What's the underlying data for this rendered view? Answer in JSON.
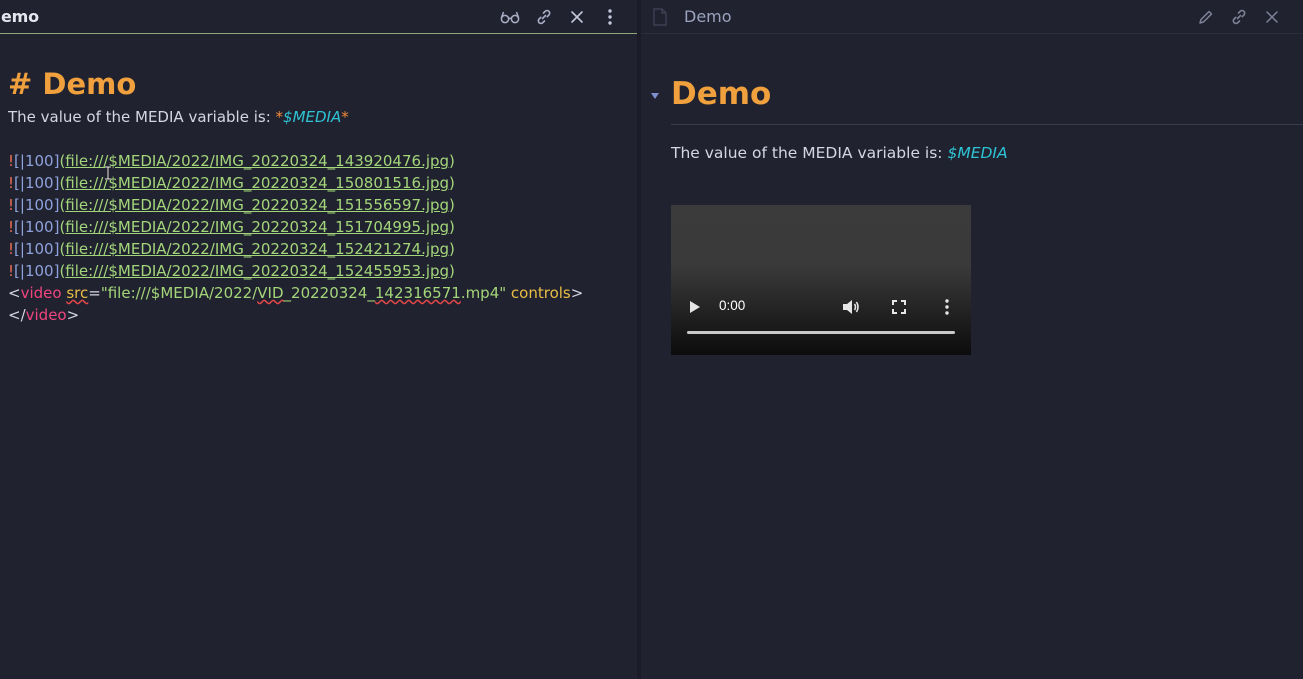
{
  "left_pane": {
    "title": "emo",
    "icons": [
      "reading-glasses-icon",
      "link-icon",
      "close-icon",
      "more-vertical-icon"
    ]
  },
  "right_pane": {
    "title": "Demo",
    "icons": [
      "file-icon",
      "pencil-icon",
      "link-icon",
      "close-icon"
    ]
  },
  "editor": {
    "heading": "# Demo",
    "para_text": "The value of the MEDIA variable is: ",
    "star": "*",
    "para_var": "$MEDIA",
    "images": [
      {
        "bang": "!",
        "alias_open": "[",
        "alias_sep": "|",
        "alias_size": "100",
        "alias_close": "]",
        "open": "(",
        "url": "file:///$MEDIA/2022/IMG_20220324_143920476.jpg",
        "close": ")"
      },
      {
        "bang": "!",
        "alias_open": "[",
        "alias_sep": "|",
        "alias_size": "100",
        "alias_close": "]",
        "open": "(",
        "url": "file:///$MEDIA/2022/IMG_20220324_150801516.jpg",
        "close": ")"
      },
      {
        "bang": "!",
        "alias_open": "[",
        "alias_sep": "|",
        "alias_size": "100",
        "alias_close": "]",
        "open": "(",
        "url": "file:///$MEDIA/2022/IMG_20220324_151556597.jpg",
        "close": ")"
      },
      {
        "bang": "!",
        "alias_open": "[",
        "alias_sep": "|",
        "alias_size": "100",
        "alias_close": "]",
        "open": "(",
        "url": "file:///$MEDIA/2022/IMG_20220324_151704995.jpg",
        "close": ")"
      },
      {
        "bang": "!",
        "alias_open": "[",
        "alias_sep": "|",
        "alias_size": "100",
        "alias_close": "]",
        "open": "(",
        "url": "file:///$MEDIA/2022/IMG_20220324_152421274.jpg",
        "close": ")"
      },
      {
        "bang": "!",
        "alias_open": "[",
        "alias_sep": "|",
        "alias_size": "100",
        "alias_close": "]",
        "open": "(",
        "url": "file:///$MEDIA/2022/IMG_20220324_152455953.jpg",
        "close": ")"
      }
    ],
    "video_line": {
      "lt": "<",
      "tag": "video",
      "sp": " ",
      "attr": "src",
      "eq": "=",
      "q1": "\"",
      "val_a": "file:///$MEDIA/2022/",
      "val_sq1": "VID",
      "val_mid": "_20220324_",
      "val_sq2": "142316571",
      "val_end": ".mp4",
      "q2": "\"",
      "ctrl": " controls",
      "gt": ">"
    },
    "close_line": {
      "lt": "</",
      "tag": "video",
      "gt": ">"
    }
  },
  "preview": {
    "heading": "Demo",
    "para_text": "The value of the MEDIA variable is: ",
    "para_var": "$MEDIA",
    "video": {
      "time": "0:00"
    }
  },
  "colors": {
    "background": "#21222f",
    "heading": "#f0a03c",
    "variable": "#2ec4d6",
    "link": "#a3d67a",
    "tag": "#f0457e",
    "attr": "#e9bd45"
  }
}
